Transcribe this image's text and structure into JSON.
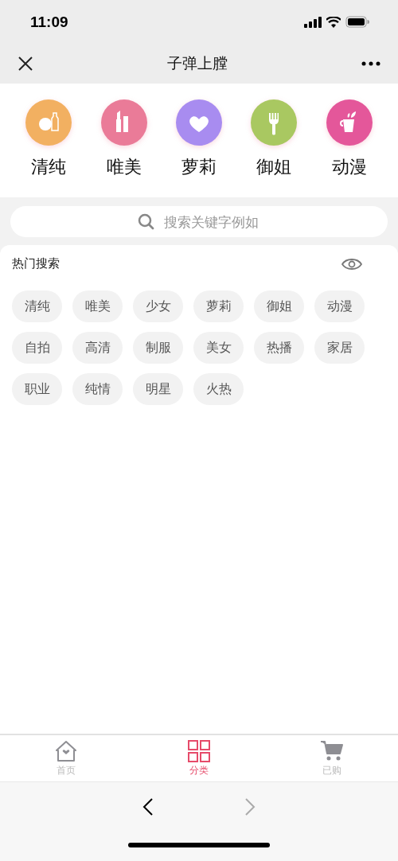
{
  "status_bar": {
    "time": "11:09"
  },
  "nav_bar": {
    "title": "子弹上膛"
  },
  "categories": [
    {
      "label": "清纯",
      "color": "#f2b061"
    },
    {
      "label": "唯美",
      "color": "#ea7b98"
    },
    {
      "label": "萝莉",
      "color": "#a88cf0"
    },
    {
      "label": "御姐",
      "color": "#a9c861"
    },
    {
      "label": "动漫",
      "color": "#e4579a"
    }
  ],
  "search": {
    "placeholder": "搜索关键字例如"
  },
  "hot_search": {
    "title": "热门搜索",
    "tags": [
      "清纯",
      "唯美",
      "少女",
      "萝莉",
      "御姐",
      "动漫",
      "自拍",
      "高清",
      "制服",
      "美女",
      "热播",
      "家居",
      "职业",
      "纯情",
      "明星",
      "火热"
    ]
  },
  "tab_bar": [
    {
      "label": "首页",
      "selected": false
    },
    {
      "label": "分类",
      "selected": true
    },
    {
      "label": "已购",
      "selected": false
    }
  ],
  "browser_nav": {
    "back": {
      "disabled": false
    },
    "forward": {
      "disabled": true
    }
  }
}
